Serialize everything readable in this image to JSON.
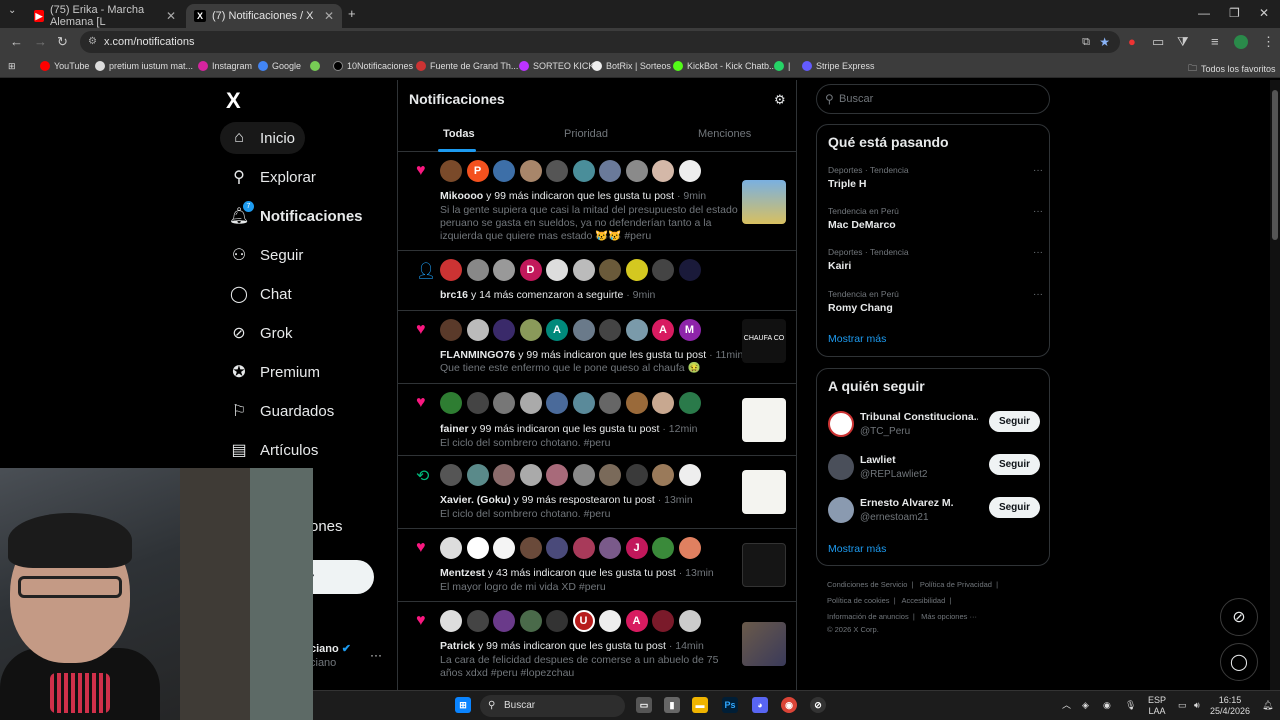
{
  "browser": {
    "tabs": [
      {
        "title": "(75) Erika - Marcha Alemana [L",
        "active": false
      },
      {
        "title": "(7) Notificaciones / X",
        "active": true
      }
    ],
    "url": "x.com/notifications",
    "bookmarks": [
      "YouTube",
      "pretium iustum mat...",
      "Instagram",
      "Google",
      "10Notificaciones",
      "Fuente de Grand Th...",
      "SORTEO KICK",
      "BotRix | Sorteos",
      "KickBot - Kick Chatb...",
      "Stripe Express"
    ],
    "all_favorites": "Todos los favoritos"
  },
  "sidebar": {
    "logo": "X",
    "items": [
      {
        "label": "Inicio"
      },
      {
        "label": "Explorar"
      },
      {
        "label": "Notificaciones",
        "badge": "7"
      },
      {
        "label": "Seguir"
      },
      {
        "label": "Chat"
      },
      {
        "label": "Grok"
      },
      {
        "label": "Premium"
      },
      {
        "label": "Guardados"
      },
      {
        "label": "Artículos"
      }
    ],
    "partial_label": "ones",
    "post_button": "r",
    "account_name": "ciano",
    "account_handle": "ciano"
  },
  "main": {
    "title": "Notificaciones",
    "tabs": [
      "Todas",
      "Prioridad",
      "Menciones"
    ],
    "notifications": [
      {
        "user": "Mikoooo",
        "action": "y 99 más indicaron que les gusta tu post",
        "time": "· 9min",
        "text": "Si la gente supiera que casi la mitad del presupuesto del estado peruano se gasta en sueldos, ya no defenderían tanto a la izquierda que quiere mas estado 😿😿 #peru"
      },
      {
        "user": "brc16",
        "action": "y 14 más comenzaron a seguirte",
        "time": "· 9min",
        "text": ""
      },
      {
        "user": "FLANMINGO76",
        "action": "y 99 más indicaron que les gusta tu post",
        "time": "· 11min",
        "text": "Que tiene este enfermo que le pone queso al chaufa 🤢"
      },
      {
        "user": "fainer",
        "action": "y 99 más indicaron que les gusta tu post",
        "time": "· 12min",
        "text": "El ciclo del sombrero chotano. #peru"
      },
      {
        "user": "Xavier. (Goku)",
        "action": "y 99 más respostearon tu post",
        "time": "· 13min",
        "text": "El ciclo del sombrero chotano. #peru"
      },
      {
        "user": "Mentzest",
        "action": "y 43 más indicaron que les gusta tu post",
        "time": "· 13min",
        "text": "El mayor logro de mi vida XD #peru"
      },
      {
        "user": "Patrick",
        "action": "y 99 más indicaron que les gusta tu post",
        "time": "· 14min",
        "text": "La cara de felicidad despues de comerse a un abuelo de 75 años xdxd #peru #lopezchau"
      }
    ],
    "thumb_texts": {
      "chaufa": "CHAUFA CO"
    }
  },
  "right": {
    "search_placeholder": "Buscar",
    "trends_title": "Qué está pasando",
    "trends": [
      {
        "category": "Deportes · Tendencia",
        "name": "Triple H"
      },
      {
        "category": "Tendencia en Perú",
        "name": "Mac DeMarco"
      },
      {
        "category": "Deportes · Tendencia",
        "name": "Kairi"
      },
      {
        "category": "Tendencia en Perú",
        "name": "Romy Chang"
      }
    ],
    "show_more": "Mostrar más",
    "follow_title": "A quién seguir",
    "follow": [
      {
        "name": "Tribunal Constituciona...",
        "handle": "@TC_Peru",
        "button": "Seguir"
      },
      {
        "name": "Lawliet",
        "handle": "@REPLawliet2",
        "button": "Seguir"
      },
      {
        "name": "Ernesto Alvarez M.",
        "handle": "@ernestoam21",
        "button": "Seguir"
      }
    ],
    "footer": [
      "Condiciones de Servicio",
      "Política de Privacidad",
      "Política de cookies",
      "Accesibilidad",
      "Información de anuncios",
      "Más opciones ···",
      "© 2026 X Corp."
    ]
  },
  "taskbar": {
    "search": "Buscar",
    "lang": "ESP",
    "lang2": "LAA",
    "time": "16:15",
    "date": "25/4/2026"
  },
  "colors": {
    "accent": "#1d9bf0",
    "like": "#f91880",
    "repost": "#00ba7c"
  }
}
